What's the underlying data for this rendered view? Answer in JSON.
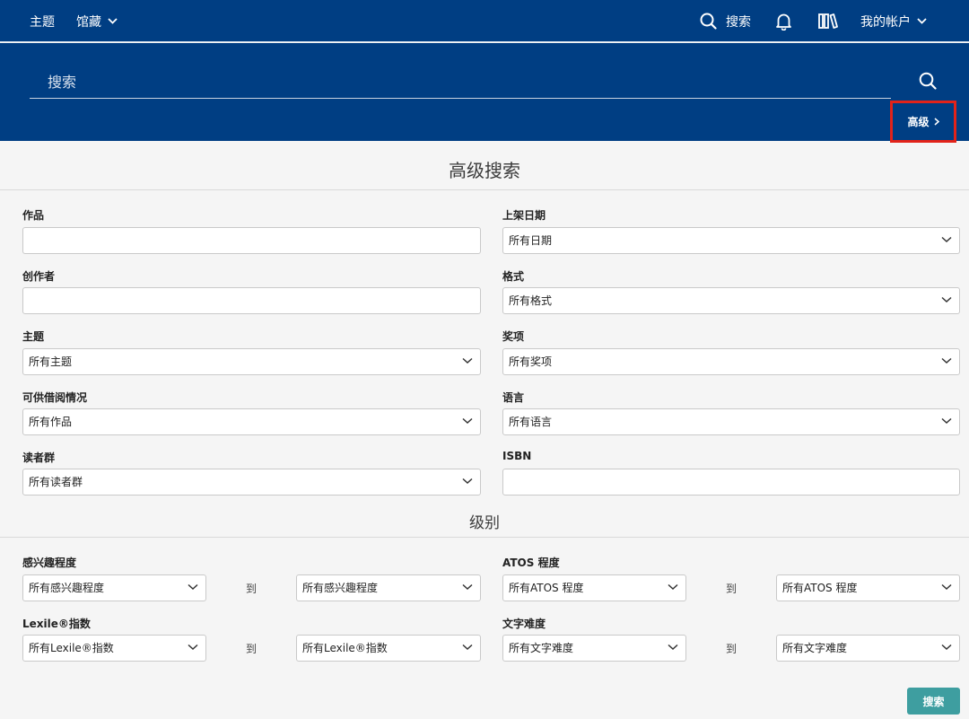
{
  "nav": {
    "topics": "主题",
    "collections": "馆藏",
    "search": "搜索",
    "my_account": "我的帐户"
  },
  "banner": {
    "search_placeholder": "搜索",
    "advanced_label": "高级"
  },
  "form": {
    "title": "高级搜索",
    "left": {
      "works_label": "作品",
      "creator_label": "创作者",
      "subject_label": "主题",
      "subject_value": "所有主题",
      "availability_label": "可供借阅情况",
      "availability_value": "所有作品",
      "audience_label": "读者群",
      "audience_value": "所有读者群"
    },
    "right": {
      "date_label": "上架日期",
      "date_value": "所有日期",
      "format_label": "格式",
      "format_value": "所有格式",
      "award_label": "奖项",
      "award_value": "所有奖项",
      "language_label": "语言",
      "language_value": "所有语言",
      "isbn_label": "ISBN"
    }
  },
  "levels": {
    "title": "级别",
    "to": "到",
    "interest_label": "感兴趣程度",
    "interest_value": "所有感兴趣程度",
    "atos_label": "ATOS 程度",
    "atos_value": "所有ATOS 程度",
    "lexile_label": "Lexile®指数",
    "lexile_value": "所有Lexile®指数",
    "text_difficulty_label": "文字难度",
    "text_difficulty_value": "所有文字难度"
  },
  "submit_label": "搜索",
  "colors": {
    "nav_bg": "#003e83",
    "highlight_border": "#e2231a",
    "submit_bg": "#3e9ea0"
  }
}
